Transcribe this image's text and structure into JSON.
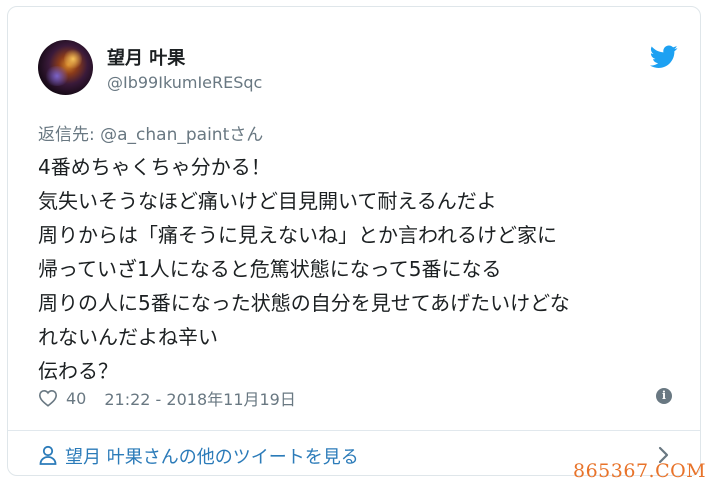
{
  "user": {
    "display_name": "望月 叶果",
    "handle": "@Ib99IkumIeRESqc"
  },
  "reply": {
    "prefix": "返信先: ",
    "mention": "@a_chan_paint",
    "suffix": "さん"
  },
  "tweet": {
    "lines": [
      "4番めちゃくちゃ分かる！",
      "気失いそうなほど痛いけど目見開いて耐えるんだよ",
      "周りからは「痛そうに見えないね」とか言われるけど家に",
      "帰っていざ1人になると危篤状態になって5番になる",
      "周りの人に5番になった状態の自分を見せてあげたいけどな",
      "れないんだよね辛い",
      "伝わる？"
    ]
  },
  "meta": {
    "likes": "40",
    "timestamp": "21:22 - 2018年11月19日"
  },
  "footer": {
    "more_tweets_label": "望月 叶果さんの他のツイートを見る"
  },
  "watermark": "865367.COM",
  "icons": {
    "brand": "twitter-bird-icon",
    "like": "heart-icon",
    "info": "info-icon",
    "person": "person-icon",
    "chevron": "chevron-right-icon"
  },
  "colors": {
    "twitter_blue": "#1da1f2",
    "link_blue": "#2b7bb9",
    "text": "#1c2022",
    "secondary": "#697882",
    "watermark": "#e8732a"
  }
}
